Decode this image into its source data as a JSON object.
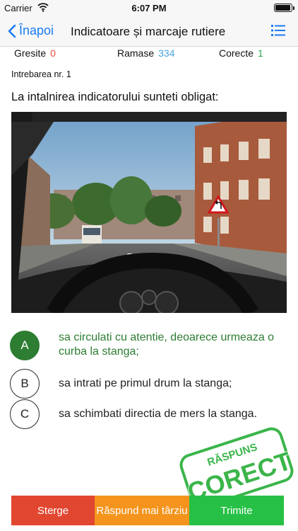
{
  "status_bar": {
    "carrier": "Carrier",
    "time": "6:07 PM"
  },
  "nav": {
    "back_label": "Înapoi",
    "title": "Indicatoare și marcaje rutiere"
  },
  "stats": {
    "wrong_label": "Gresite",
    "wrong_value": "0",
    "remaining_label": "Ramase",
    "remaining_value": "334",
    "correct_label": "Corecte",
    "correct_value": "1"
  },
  "question": {
    "number_label": "Intrebarea nr. 1",
    "text": "La intalnirea indicatorului sunteti obligat:"
  },
  "answers": [
    {
      "letter": "A",
      "text": "sa circulati cu atentie, deoarece urmeaza o curba la stanga;",
      "selected": true
    },
    {
      "letter": "B",
      "text": "sa intrati pe primul drum la stanga;",
      "selected": false
    },
    {
      "letter": "C",
      "text": "sa schimbati directia de mers la stanga.",
      "selected": false
    }
  ],
  "stamp": {
    "top_text": "RĂSPUNS",
    "main_text": "CORECT"
  },
  "actions": {
    "delete_label": "Sterge",
    "later_label": "Răspund mai târziu",
    "send_label": "Trimite"
  },
  "colors": {
    "accent_blue": "#1a7cf2",
    "wrong_red": "#e8483b",
    "remaining_blue": "#4aa3df",
    "correct_green": "#34a853",
    "selected_answer_green": "#2d7d32",
    "delete_button": "#e14630",
    "later_button": "#f5941d",
    "send_button": "#27c046",
    "stamp_green": "#3bb54a"
  }
}
